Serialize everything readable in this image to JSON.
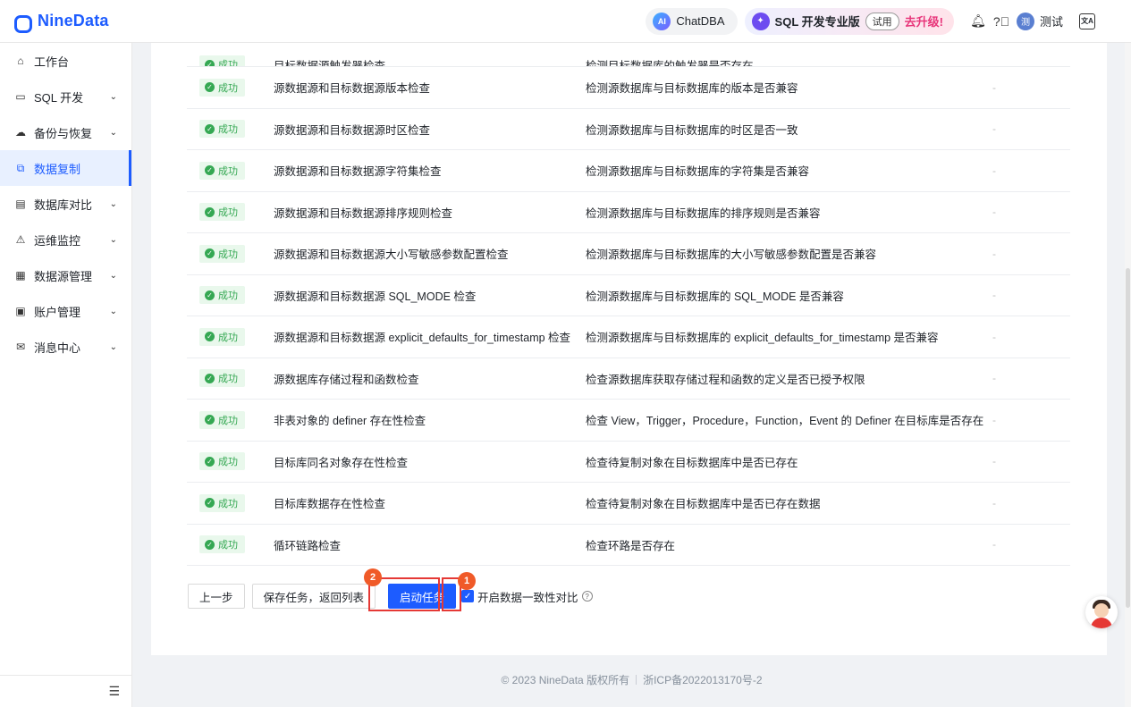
{
  "app": {
    "logo": "NineData"
  },
  "topbar": {
    "chatdba": "ChatDBA",
    "ai_badge": "AI",
    "pro_title": "SQL 开发专业版",
    "trial": "试用",
    "upgrade": "去升级!",
    "user": "测试",
    "avatar_letter": "测"
  },
  "sidebar": {
    "items": [
      {
        "label": "工作台",
        "icon": "home-icon",
        "glyph": "⌂",
        "chevron": false
      },
      {
        "label": "SQL 开发",
        "icon": "monitor-icon",
        "glyph": "▭",
        "chevron": true
      },
      {
        "label": "备份与恢复",
        "icon": "cloud-icon",
        "glyph": "☁",
        "chevron": true
      },
      {
        "label": "数据复制",
        "icon": "copy-icon",
        "glyph": "⧉",
        "chevron": false,
        "active": true
      },
      {
        "label": "数据库对比",
        "icon": "compare-icon",
        "glyph": "▤",
        "chevron": true
      },
      {
        "label": "运维监控",
        "icon": "alarm-icon",
        "glyph": "⚠",
        "chevron": true
      },
      {
        "label": "数据源管理",
        "icon": "datasource-icon",
        "glyph": "▦",
        "chevron": true
      },
      {
        "label": "账户管理",
        "icon": "account-icon",
        "glyph": "▣",
        "chevron": true
      },
      {
        "label": "消息中心",
        "icon": "mail-icon",
        "glyph": "✉",
        "chevron": true
      }
    ]
  },
  "checks": {
    "status_label": "成功",
    "note_placeholder": "-",
    "rows": [
      {
        "name": "目标数据源触发器检查",
        "desc": "检测目标数据库的触发器是否存在"
      },
      {
        "name": "源数据源和目标数据源版本检查",
        "desc": "检测源数据库与目标数据库的版本是否兼容"
      },
      {
        "name": "源数据源和目标数据源时区检查",
        "desc": "检测源数据库与目标数据库的时区是否一致"
      },
      {
        "name": "源数据源和目标数据源字符集检查",
        "desc": "检测源数据库与目标数据库的字符集是否兼容"
      },
      {
        "name": "源数据源和目标数据源排序规则检查",
        "desc": "检测源数据库与目标数据库的排序规则是否兼容"
      },
      {
        "name": "源数据源和目标数据源大小写敏感参数配置检查",
        "desc": "检测源数据库与目标数据库的大小写敏感参数配置是否兼容"
      },
      {
        "name": "源数据源和目标数据源 SQL_MODE 检查",
        "desc": "检测源数据库与目标数据库的 SQL_MODE 是否兼容"
      },
      {
        "name": "源数据源和目标数据源 explicit_defaults_for_timestamp 检查",
        "desc": "检测源数据库与目标数据库的 explicit_defaults_for_timestamp 是否兼容"
      },
      {
        "name": "源数据库存储过程和函数检查",
        "desc": "检查源数据库获取存储过程和函数的定义是否已授予权限"
      },
      {
        "name": "非表对象的 definer 存在性检查",
        "desc": "检查 View，Trigger，Procedure，Function，Event 的 Definer 在目标库是否存在"
      },
      {
        "name": "目标库同名对象存在性检查",
        "desc": "检查待复制对象在目标数据库中是否已存在"
      },
      {
        "name": "目标库数据存在性检查",
        "desc": "检查待复制对象在目标数据库中是否已存在数据"
      },
      {
        "name": "循环链路检查",
        "desc": "检查环路是否存在"
      }
    ]
  },
  "actions": {
    "prev": "上一步",
    "save": "保存任务，返回列表",
    "start": "启动任务",
    "consistency_label": "开启数据一致性对比",
    "consistency_checked": true,
    "step_1": "1",
    "step_2": "2"
  },
  "footer": {
    "copyright": "© 2023 NineData 版权所有",
    "icp": "浙ICP备2022013170号-2"
  }
}
